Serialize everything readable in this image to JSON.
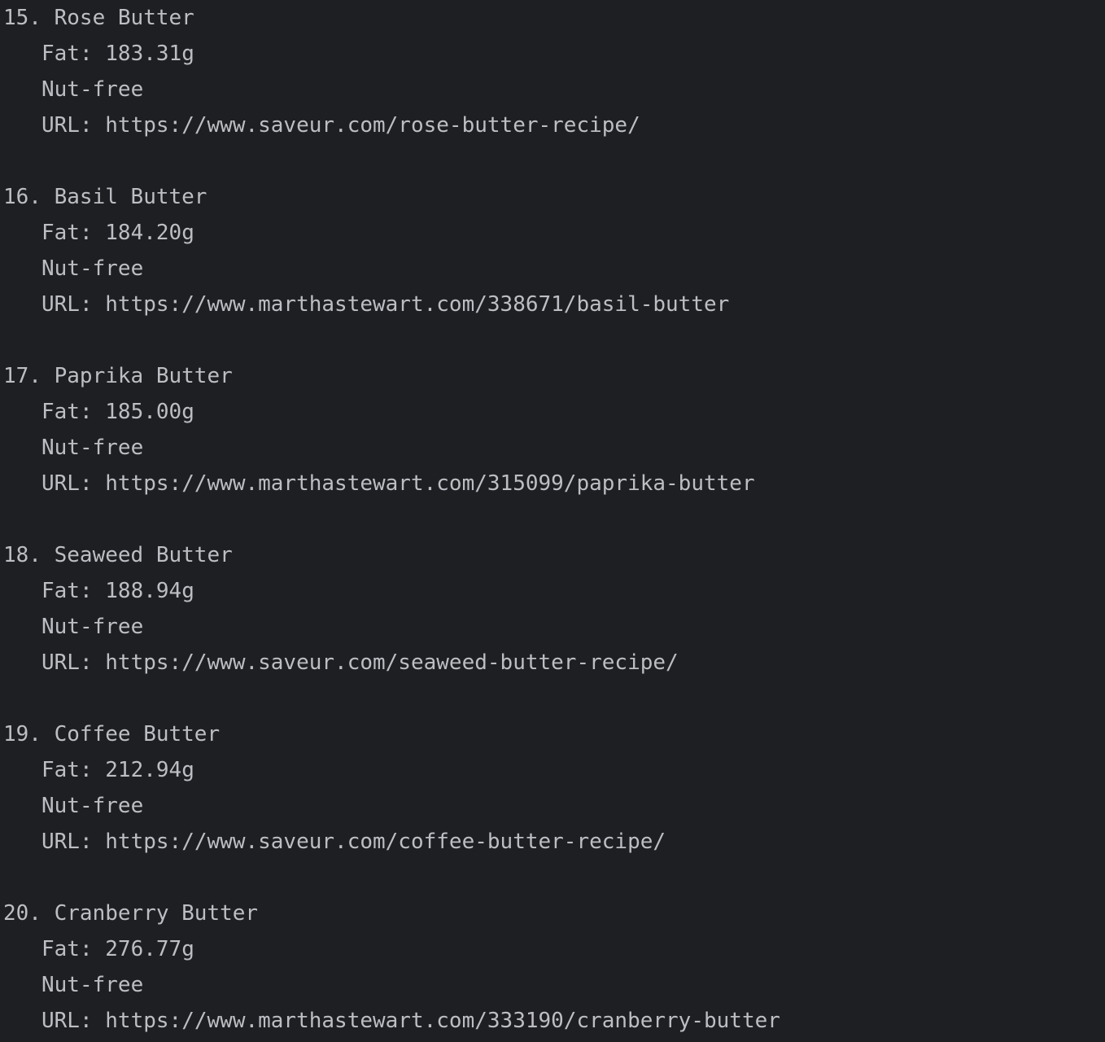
{
  "recipes": [
    {
      "number": "15.",
      "name": "Rose Butter",
      "fat_label": "Fat:",
      "fat": "183.31g",
      "allergen": "Nut-free",
      "url_label": "URL:",
      "url": "https://www.saveur.com/rose-butter-recipe/"
    },
    {
      "number": "16.",
      "name": "Basil Butter",
      "fat_label": "Fat:",
      "fat": "184.20g",
      "allergen": "Nut-free",
      "url_label": "URL:",
      "url": "https://www.marthastewart.com/338671/basil-butter"
    },
    {
      "number": "17.",
      "name": "Paprika Butter",
      "fat_label": "Fat:",
      "fat": "185.00g",
      "allergen": "Nut-free",
      "url_label": "URL:",
      "url": "https://www.marthastewart.com/315099/paprika-butter"
    },
    {
      "number": "18.",
      "name": "Seaweed Butter",
      "fat_label": "Fat:",
      "fat": "188.94g",
      "allergen": "Nut-free",
      "url_label": "URL:",
      "url": "https://www.saveur.com/seaweed-butter-recipe/"
    },
    {
      "number": "19.",
      "name": "Coffee Butter",
      "fat_label": "Fat:",
      "fat": "212.94g",
      "allergen": "Nut-free",
      "url_label": "URL:",
      "url": "https://www.saveur.com/coffee-butter-recipe/"
    },
    {
      "number": "20.",
      "name": "Cranberry Butter",
      "fat_label": "Fat:",
      "fat": "276.77g",
      "allergen": "Nut-free",
      "url_label": "URL:",
      "url": "https://www.marthastewart.com/333190/cranberry-butter"
    }
  ]
}
